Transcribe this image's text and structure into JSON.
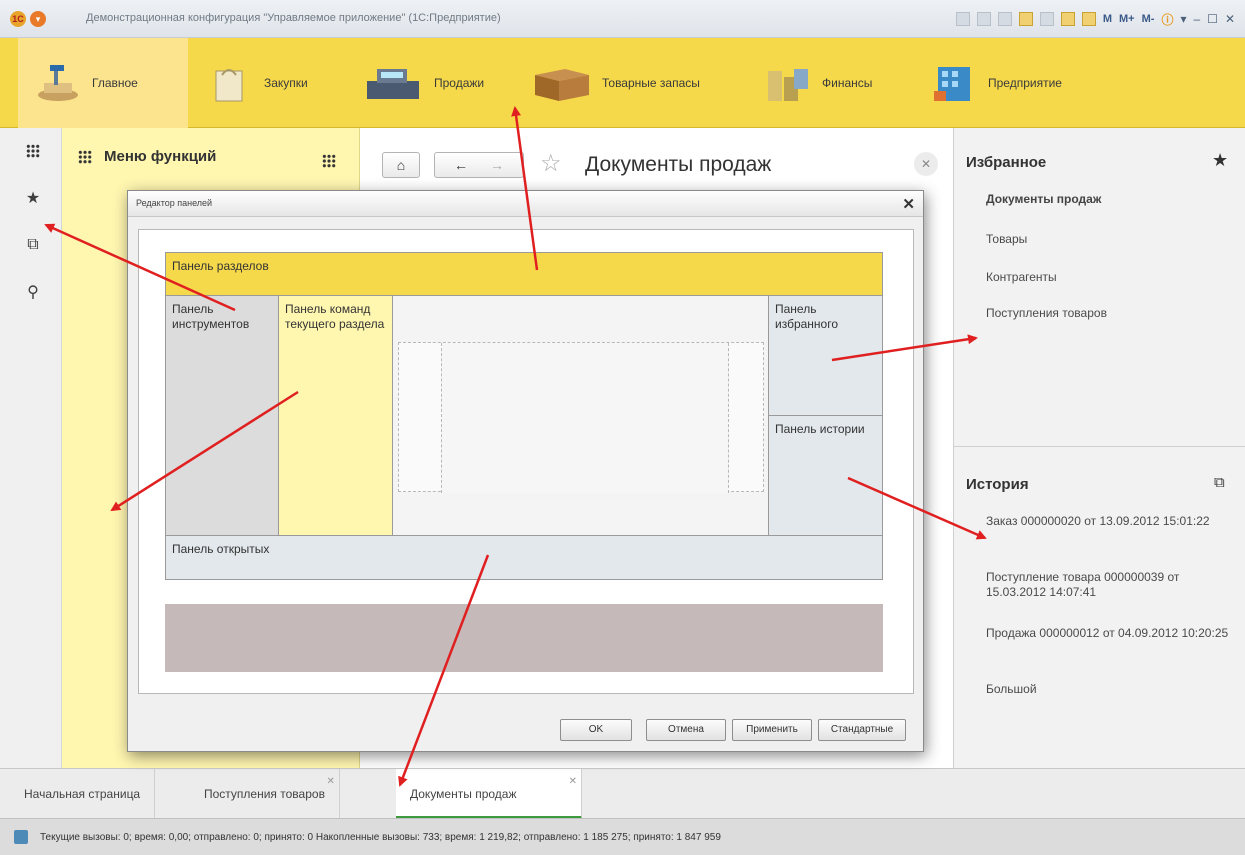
{
  "window": {
    "title": "Демонстрационная конфигурация \"Управляемое приложение\" (1С:Предприятие)",
    "logo_text": "1С",
    "memory_buttons": [
      "M",
      "M+",
      "M-"
    ]
  },
  "sections": [
    {
      "label": "Главное",
      "icon": "home-desk-icon",
      "active": true
    },
    {
      "label": "Закупки",
      "icon": "shopping-bag-icon",
      "active": false
    },
    {
      "label": "Продажи",
      "icon": "cash-register-icon",
      "active": false
    },
    {
      "label": "Товарные запасы",
      "icon": "box-icon",
      "active": false
    },
    {
      "label": "Финансы",
      "icon": "coins-icon",
      "active": false
    },
    {
      "label": "Предприятие",
      "icon": "building-icon",
      "active": false
    }
  ],
  "toolbar": {
    "icons": [
      "grid-icon",
      "star-icon",
      "history-icon",
      "search-icon"
    ]
  },
  "function_menu": {
    "title": "Меню функций"
  },
  "document": {
    "title": "Документы продаж"
  },
  "favorites": {
    "title": "Избранное",
    "items": [
      "Документы продаж",
      "Товары",
      "Контрагенты",
      "Поступления товаров"
    ]
  },
  "history": {
    "title": "История",
    "items": [
      "Заказ 000000020 от 13.09.2012 15:01:22",
      "Поступление товара 000000039 от 15.03.2012 14:07:41",
      "Продажа 000000012 от 04.09.2012 10:20:25",
      "Большой"
    ]
  },
  "open_tabs": [
    {
      "label": "Начальная страница",
      "active": false,
      "closable": false
    },
    {
      "label": "Поступления товаров",
      "active": false,
      "closable": true
    },
    {
      "label": "Документы продаж",
      "active": true,
      "closable": true
    }
  ],
  "status": {
    "text": "Текущие вызовы: 0; время: 0,00; отправлено: 0; принято: 0   Накопленные вызовы: 733; время: 1 219,82; отправлено: 1 185 275; принято: 1 847 959"
  },
  "dialog": {
    "title": "Редактор панелей",
    "panels": {
      "sections": "Панель разделов",
      "tools": "Панель инструментов",
      "current_section_commands": "Панель команд текущего раздела",
      "favorites": "Панель избранного",
      "history": "Панель истории",
      "open": "Панель открытых"
    },
    "buttons": {
      "ok": "OK",
      "cancel": "Отмена",
      "apply": "Применить",
      "defaults": "Стандартные"
    }
  },
  "colors": {
    "sections_panel": "#f6d94b",
    "function_menu": "#fff6b0",
    "annotation_arrow": "#e02020",
    "active_tab_underline": "#3d9a3d"
  }
}
